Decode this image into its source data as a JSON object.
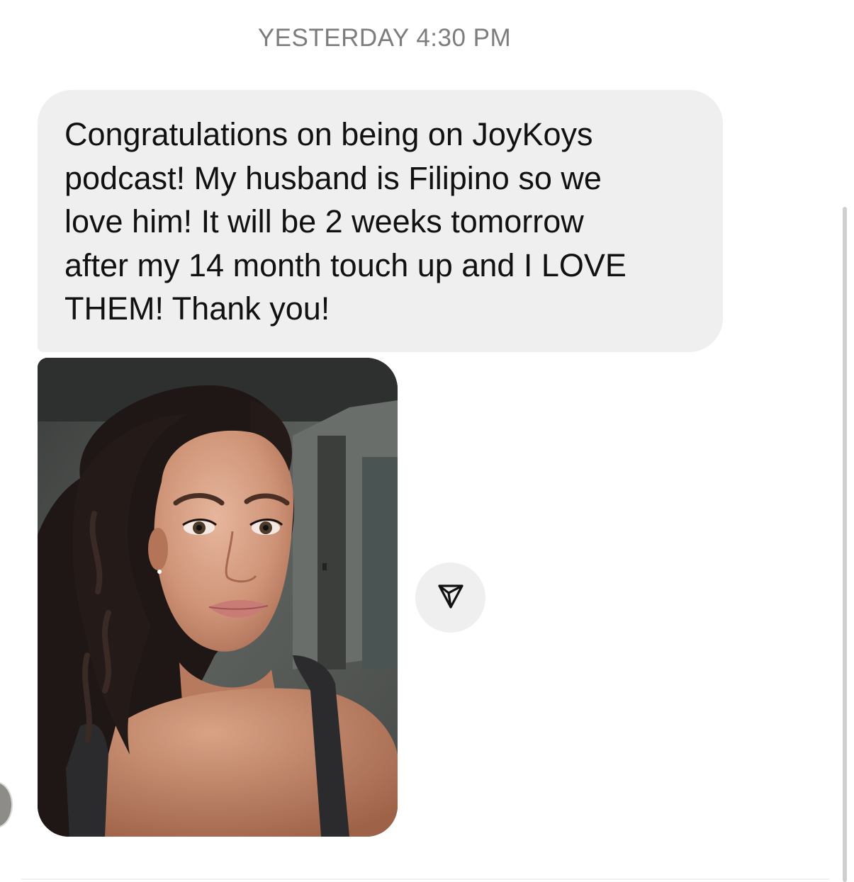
{
  "thread": {
    "timestamp": "YESTERDAY 4:30 PM"
  },
  "message": {
    "lines": [
      "Congratulations on being on JoyKoys",
      "podcast! My husband is Filipino so we",
      "love him! It will be 2 weeks tomorrow",
      "after my 14 month touch up and I LOVE",
      "THEM! Thank you!"
    ]
  },
  "icons": {
    "share": "paper-plane-icon"
  },
  "colors": {
    "bubble_bg": "#efefef",
    "timestamp_text": "#7d7d7d",
    "message_text": "#111111"
  }
}
